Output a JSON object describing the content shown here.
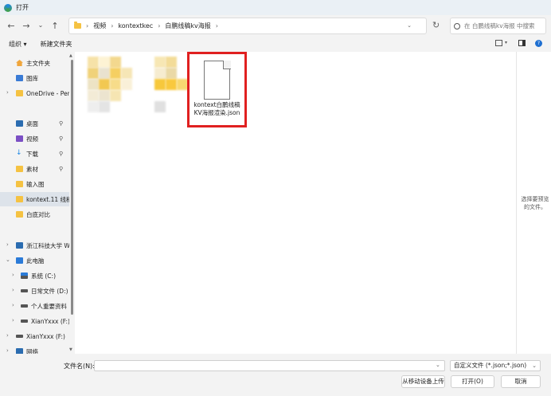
{
  "window": {
    "title": "打开"
  },
  "breadcrumb": {
    "items": [
      "视频",
      "kontextkec",
      "白鹏线稿kv海报"
    ],
    "separator": "›"
  },
  "search": {
    "placeholder": "在 白鹏线稿kv海报 中搜索"
  },
  "toolbar": {
    "organize": "组织 ▾",
    "new_folder": "新建文件夹"
  },
  "sidebar": {
    "items": [
      {
        "label": "主文件夹",
        "icon": "home-icon"
      },
      {
        "label": "图库",
        "icon": "gallery-icon"
      },
      {
        "label": "OneDrive - Per",
        "icon": "folder-icon"
      },
      {
        "label": "桌面",
        "icon": "desktop-icon"
      },
      {
        "label": "视频",
        "icon": "video-icon"
      },
      {
        "label": "下载",
        "icon": "download-icon"
      },
      {
        "label": "素材",
        "icon": "folder-icon"
      },
      {
        "label": "输入图",
        "icon": "folder-icon"
      },
      {
        "label": "kontext.11 线稿",
        "icon": "folder-icon"
      },
      {
        "label": "白底对比",
        "icon": "folder-icon"
      },
      {
        "label": "浙江科技大学 W",
        "icon": "network-icon"
      },
      {
        "label": "此电脑",
        "icon": "pc-icon"
      },
      {
        "label": "系统 (C:)",
        "icon": "system-drive-icon"
      },
      {
        "label": "日常文件 (D:)",
        "icon": "drive-icon"
      },
      {
        "label": "个人重要资料 (",
        "icon": "drive-icon"
      },
      {
        "label": "XianYxxx (F:)",
        "icon": "drive-icon"
      },
      {
        "label": "XianYxxx (F:)",
        "icon": "drive-icon"
      },
      {
        "label": "网络",
        "icon": "network-icon"
      }
    ]
  },
  "files": [
    {
      "name_line1": "kontext白鹏线稿",
      "name_line2": "KV海报渲染.json",
      "selected_highlight": "#e02020"
    }
  ],
  "preview": {
    "text": "选择要预览的文件。"
  },
  "bottom": {
    "filename_label": "文件名(N):",
    "filename_value": "",
    "filter_value": "自定义文件 (*.json;*.json)",
    "upload_button": "从移动设备上传",
    "open_button": "打开(O)",
    "cancel_button": "取消"
  }
}
